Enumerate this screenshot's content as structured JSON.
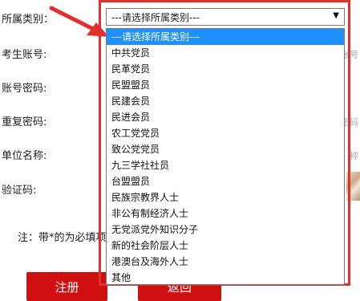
{
  "form": {
    "labels": {
      "category": "所属类别：",
      "account": "考生账号:",
      "password": "账号密码:",
      "repeat": "重复密码:",
      "unit": "单位名称:",
      "captcha": "验证码:"
    },
    "hints": {
      "account": "账号",
      "repeat": "密码",
      "unit": "称"
    },
    "note": "注：带*的为必填项",
    "buttons": {
      "register": "注册",
      "back": "返回"
    }
  },
  "select": {
    "selected": "---请选择所属类别---",
    "options": [
      "---请选择所属类别---",
      "中共党员",
      "民革党员",
      "民盟盟员",
      "民建会员",
      "民进会员",
      "农工党党员",
      "致公党党员",
      "九三学社社员",
      "台盟盟员",
      "民族宗教界人士",
      "非公有制经济人士",
      "无党派党外知识分子",
      "新的社会阶层人士",
      "港澳台及海外人士",
      "其他"
    ]
  },
  "colors": {
    "highlight": "#e0312e",
    "button": "#d01010",
    "selected_option": "#1e90ff"
  }
}
